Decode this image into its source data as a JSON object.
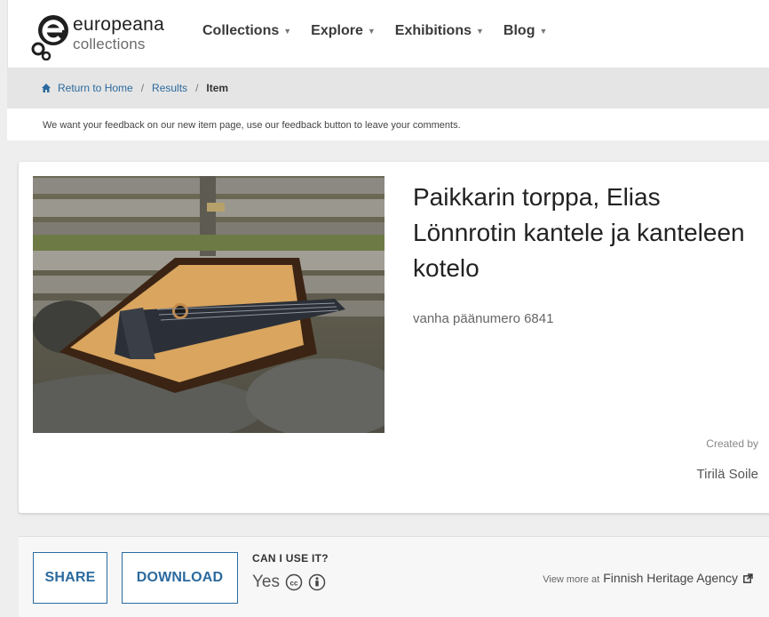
{
  "header": {
    "logo_line1": "europeana",
    "logo_line2": "collections",
    "nav": [
      {
        "label": "Collections"
      },
      {
        "label": "Explore"
      },
      {
        "label": "Exhibitions"
      },
      {
        "label": "Blog"
      }
    ]
  },
  "breadcrumb": {
    "home": "Return to Home",
    "results": "Results",
    "current": "Item",
    "separator": "/"
  },
  "feedback": {
    "text": "We want your feedback on our new item page, use our feedback button to leave your comments."
  },
  "item": {
    "title": "Paikkarin torppa, Elias Lönnrotin kantele ja kanteleen kotelo",
    "description": "vanha päänumero 6841",
    "created_by_label": "Created by",
    "created_by_value": "Tirilä Soile"
  },
  "actions": {
    "share": "SHARE",
    "download": "DOWNLOAD",
    "can_use_label": "CAN I USE IT?",
    "can_use_value": "Yes",
    "license_icons": [
      "cc-icon",
      "attribution-icon"
    ],
    "view_more_prefix": "View more at",
    "provider": "Finnish Heritage Agency"
  },
  "colors": {
    "accent": "#2b6a9e",
    "background": "#eeeeee"
  }
}
